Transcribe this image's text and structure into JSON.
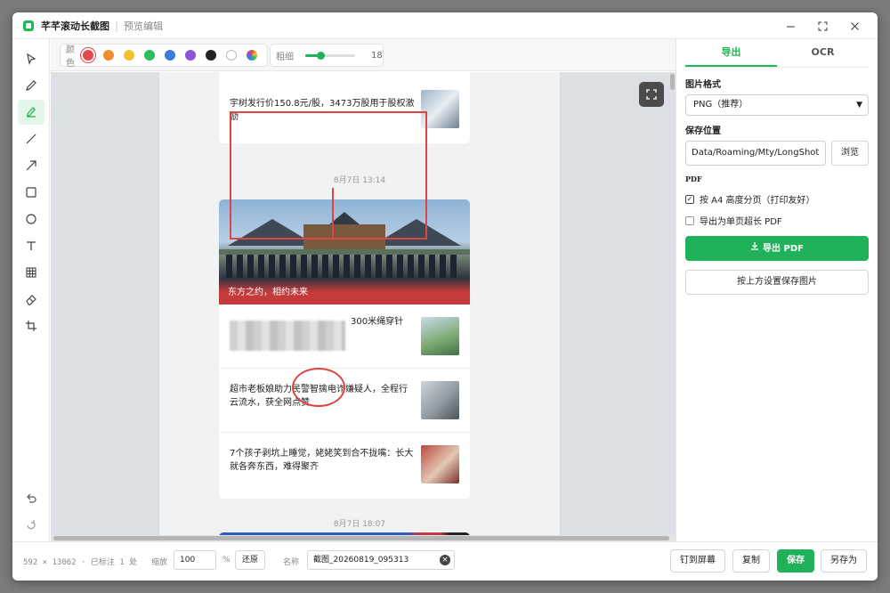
{
  "window": {
    "title": "芊芊滚动长截图",
    "subtitle": "预览编辑",
    "controls": [
      "minimize-icon",
      "maximize-icon",
      "close-icon"
    ]
  },
  "tools": [
    {
      "name": "select",
      "icon": "cursor-icon"
    },
    {
      "name": "pen",
      "icon": "pen-icon"
    },
    {
      "name": "marker",
      "icon": "highlighter-icon",
      "active": true
    },
    {
      "name": "line",
      "icon": "line-icon"
    },
    {
      "name": "arrow",
      "icon": "arrow-icon"
    },
    {
      "name": "rectangle",
      "icon": "rectangle-icon"
    },
    {
      "name": "ellipse",
      "icon": "circle-icon"
    },
    {
      "name": "text",
      "icon": "text-icon"
    },
    {
      "name": "mosaic",
      "icon": "grid-icon"
    },
    {
      "name": "eraser",
      "icon": "eraser-icon"
    },
    {
      "name": "crop",
      "icon": "crop-icon"
    },
    {
      "name": "undo",
      "icon": "undo-icon"
    },
    {
      "name": "redo",
      "icon": "redo-icon"
    }
  ],
  "toolbar": {
    "color_label": "颜色",
    "colors": [
      "#e54848",
      "#f08c2e",
      "#f2c12e",
      "#2dbd5a",
      "#3a7be0",
      "#8d55d6",
      "#222222",
      "#ffffff",
      "multi"
    ],
    "selected_color": "#e54848",
    "size_label": "粗细",
    "size_value": "18",
    "size_fraction": 0.3
  },
  "preview": {
    "items_top": [
      {
        "text": "宇树发行价150.8元/股，3473万股用于股权激励",
        "thumb": "robot-image"
      }
    ],
    "time_1": "8月7日 13:14",
    "hero_caption": "东方之约，相约未来",
    "items_mid": [
      {
        "text": "300米绳穿针",
        "thumb": "tower-image",
        "blurred": true
      },
      {
        "text": "超市老板娘助力民警智擒电诈嫌疑人，全程行云流水，获全网点赞",
        "thumb": "shop-image"
      },
      {
        "text": "7个孩子剥坑上睡觉，姥姥笑到合不拢嘴：长大就各奔东西，难得聚齐",
        "thumb": "kids-image"
      }
    ],
    "time_2": "8月7日 18:07"
  },
  "panel": {
    "tabs": [
      "导出",
      "OCR"
    ],
    "active_tab": "导出",
    "format_label": "图片格式",
    "format_value": "PNG（推荐）",
    "save_label": "保存位置",
    "save_path": "Data/Roaming/Mty/LongShot",
    "browse": "浏览",
    "pdf_label": "PDF",
    "check_a4": "按 A4 高度分页（打印友好）",
    "check_a4_checked": true,
    "check_single": "导出为单页超长 PDF",
    "check_single_checked": false,
    "export_pdf": "导出 PDF",
    "save_by_settings": "按上方设置保存图片"
  },
  "status": {
    "info": "592 × 13062 · 已标注 1 处",
    "zoom_label": "缩放",
    "zoom_value": "100",
    "zoom_unit": "%",
    "reset": "还原",
    "name_label": "名称",
    "name_value": "截图_20260819_095313",
    "pin": "钉到屏幕",
    "copy": "复制",
    "save": "保存",
    "save_as": "另存为"
  }
}
